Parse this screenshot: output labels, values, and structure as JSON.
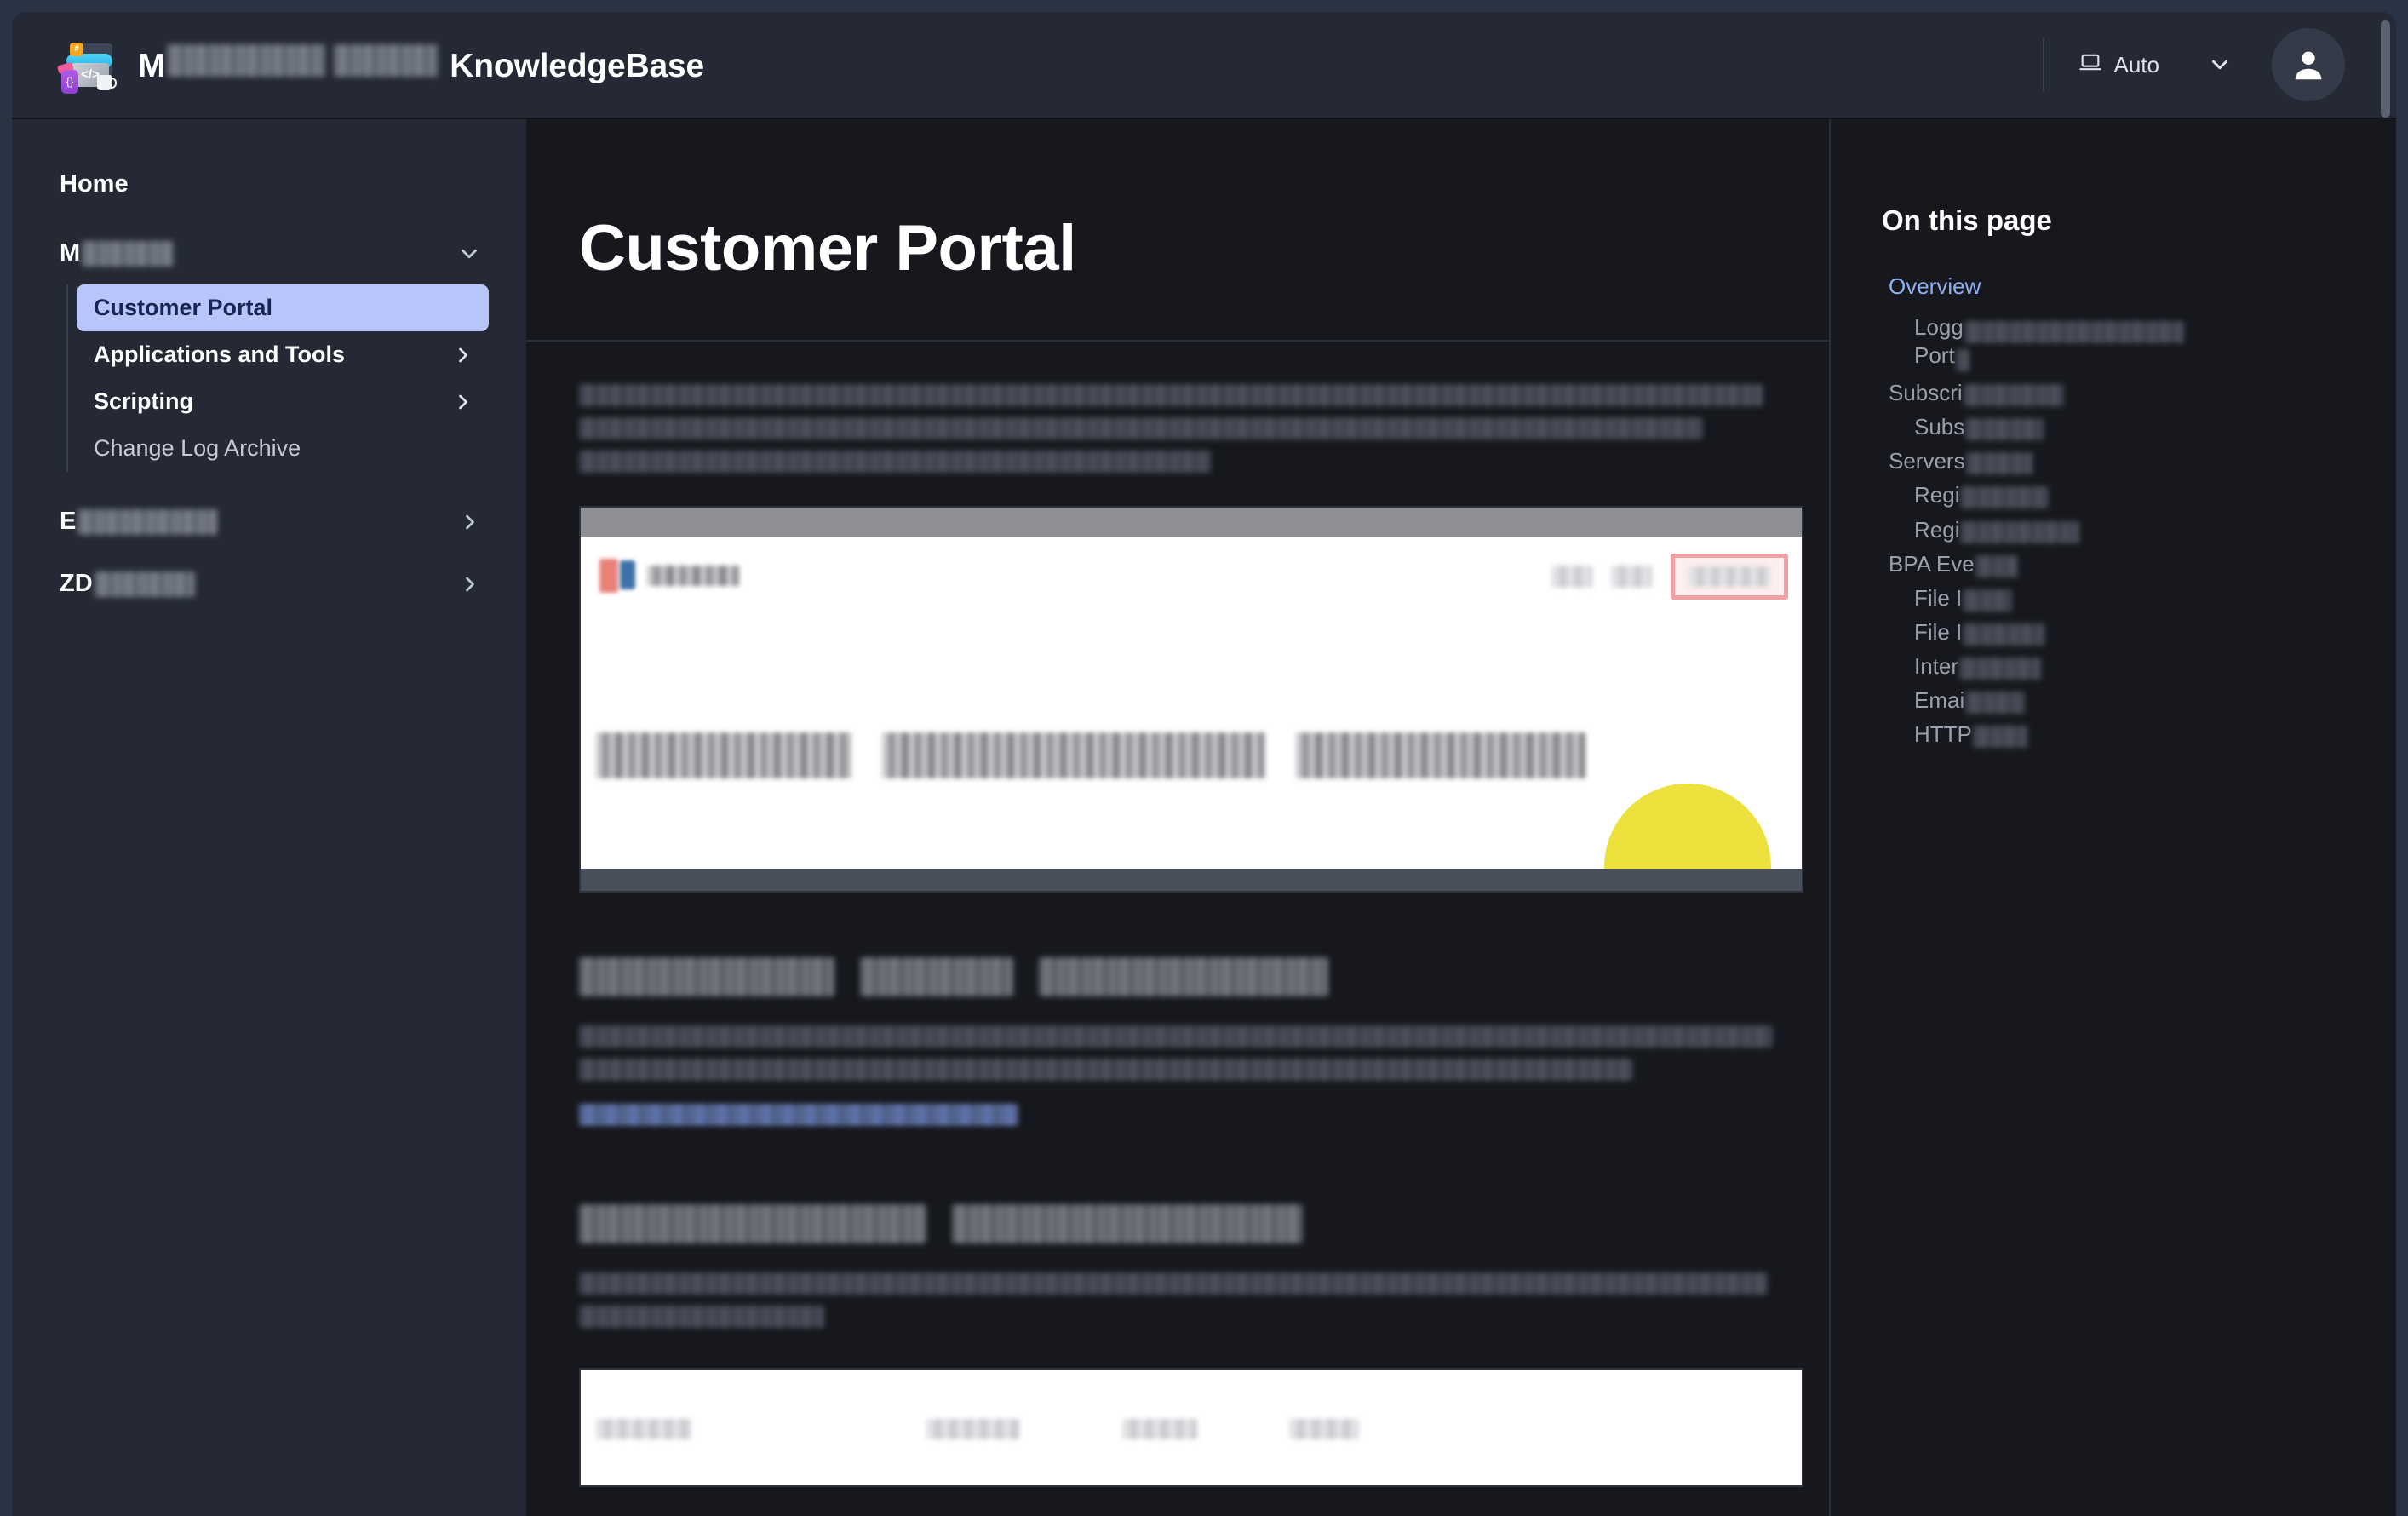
{
  "header": {
    "logo_icon": "knowledge-base-code-logo",
    "title_prefix": "M",
    "title_redacted_1": "",
    "title_redacted_2": "",
    "title_suffix": "KnowledgeBase",
    "theme": {
      "icon": "laptop-icon",
      "label": "Auto",
      "chevron_icon": "chevron-down-icon"
    },
    "avatar_icon": "user-avatar-icon"
  },
  "sidebar": {
    "home_label": "Home",
    "groups": [
      {
        "label_prefix": "M",
        "redacted": true,
        "expanded": true,
        "chevron_icon": "chevron-down-icon",
        "children": [
          {
            "label": "Customer Portal",
            "active": true,
            "has_chevron": false
          },
          {
            "label": "Applications and Tools",
            "active": false,
            "has_chevron": true,
            "chevron_icon": "chevron-right-icon"
          },
          {
            "label": "Scripting",
            "active": false,
            "has_chevron": true,
            "chevron_icon": "chevron-right-icon"
          },
          {
            "label": "Change Log Archive",
            "active": false,
            "has_chevron": false,
            "plain": true
          }
        ]
      },
      {
        "label_prefix": "E",
        "redacted": true,
        "expanded": false,
        "chevron_icon": "chevron-right-icon",
        "children": []
      },
      {
        "label_prefix": "ZD",
        "redacted": true,
        "expanded": false,
        "chevron_icon": "chevron-right-icon",
        "children": []
      }
    ]
  },
  "main": {
    "page_title": "Customer Portal",
    "intro_paragraph_redacted": true,
    "screenshot_1": {
      "alt": "customer-portal-home-screenshot",
      "nav_highlight_color": "#f2a0a4",
      "accent_shape_color": "#ece13d"
    },
    "section_1_heading_redacted": true,
    "section_1_paragraph_redacted": true,
    "section_1_link_redacted": true,
    "section_2_heading_redacted": true,
    "section_2_paragraph_redacted": true,
    "table_screenshot": {
      "alt": "subscription-table-screenshot"
    }
  },
  "toc": {
    "title": "On this page",
    "items": [
      {
        "text": "Overview",
        "level": 1,
        "active": true,
        "redacted_after": 0,
        "redact_w": 0,
        "second_line": 0
      },
      {
        "text": "Logg",
        "level": 2,
        "active": false,
        "redact_w": 262,
        "second_line": 26
      },
      {
        "text": "Subscri",
        "level": 1,
        "active": false,
        "redact_w": 118,
        "second_line": 0
      },
      {
        "text": "Subs",
        "level": 2,
        "active": false,
        "redact_w": 92,
        "second_line": 0
      },
      {
        "text": "Servers",
        "level": 1,
        "active": false,
        "redact_w": 78,
        "second_line": 0
      },
      {
        "text": "Regi",
        "level": 2,
        "active": false,
        "redact_w": 104,
        "second_line": 0
      },
      {
        "text": "Regi",
        "level": 2,
        "active": false,
        "redact_w": 140,
        "second_line": 0
      },
      {
        "text": "BPA Eve",
        "level": 1,
        "active": false,
        "redact_w": 50,
        "second_line": 0
      },
      {
        "text": "File I",
        "level": 2,
        "active": false,
        "redact_w": 58,
        "second_line": 0
      },
      {
        "text": "File I",
        "level": 2,
        "active": false,
        "redact_w": 96,
        "second_line": 0
      },
      {
        "text": "Inter",
        "level": 2,
        "active": false,
        "redact_w": 96,
        "second_line": 0
      },
      {
        "text": "Emai",
        "level": 2,
        "active": false,
        "redact_w": 70,
        "second_line": 0
      },
      {
        "text": "HTTP",
        "level": 2,
        "active": false,
        "redact_w": 64,
        "second_line": 0
      }
    ],
    "toc_label_part_2": "Port"
  },
  "colors": {
    "page_bg": "#16181d",
    "sidebar_bg": "#242935",
    "accent_active": "#b8c5fb",
    "accent_link": "#8fb0f2",
    "header_bg": "#242935"
  }
}
